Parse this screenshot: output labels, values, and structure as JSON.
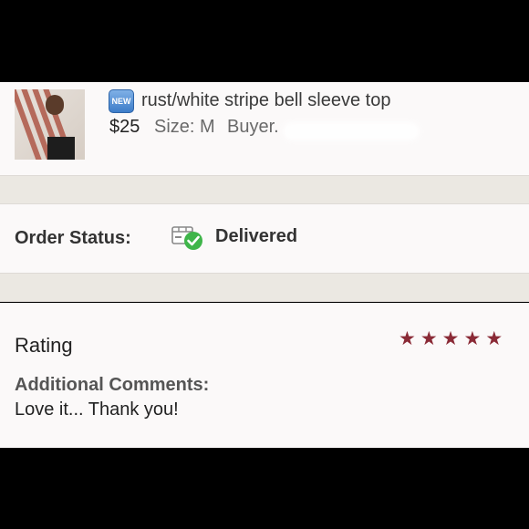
{
  "product": {
    "badge": "NEW",
    "title": "rust/white stripe bell sleeve top",
    "price": "$25",
    "size": "Size: M",
    "buyer": "Buyer."
  },
  "order_status": {
    "label": "Order Status:",
    "value": "Delivered",
    "icon": "delivered-box-icon"
  },
  "rating": {
    "title": "Rating",
    "stars": 5,
    "max_stars": 5,
    "star_color": "#8a2a36"
  },
  "comments": {
    "title": "Additional Comments:",
    "text": "Love it... Thank you!"
  }
}
